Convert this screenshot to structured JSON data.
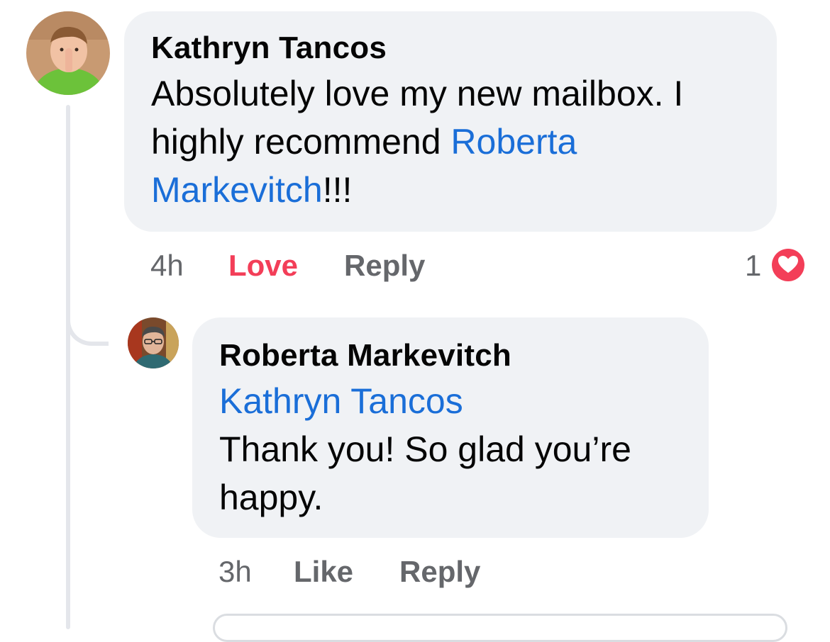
{
  "comment": {
    "author": "Kathryn Tancos",
    "text_before": "Absolutely love my new mailbox. I highly recommend ",
    "mention": "Roberta Markevitch",
    "text_after": "!!!",
    "time": "4h",
    "love_label": "Love",
    "reply_label": "Reply",
    "reaction_count": "1",
    "reaction_icon": "heart-icon",
    "avatar_icon": "child-photo-avatar"
  },
  "reply": {
    "author": "Roberta Markevitch",
    "mention": "Kathryn Tancos",
    "text": "Thank you! So glad you’re happy.",
    "time": "3h",
    "like_label": "Like",
    "reply_label": "Reply",
    "avatar_icon": "person-with-glasses-avatar"
  },
  "colors": {
    "bubble": "#f0f2f5",
    "mention": "#1a6ed8",
    "love": "#f33e58",
    "muted": "#65676b"
  }
}
